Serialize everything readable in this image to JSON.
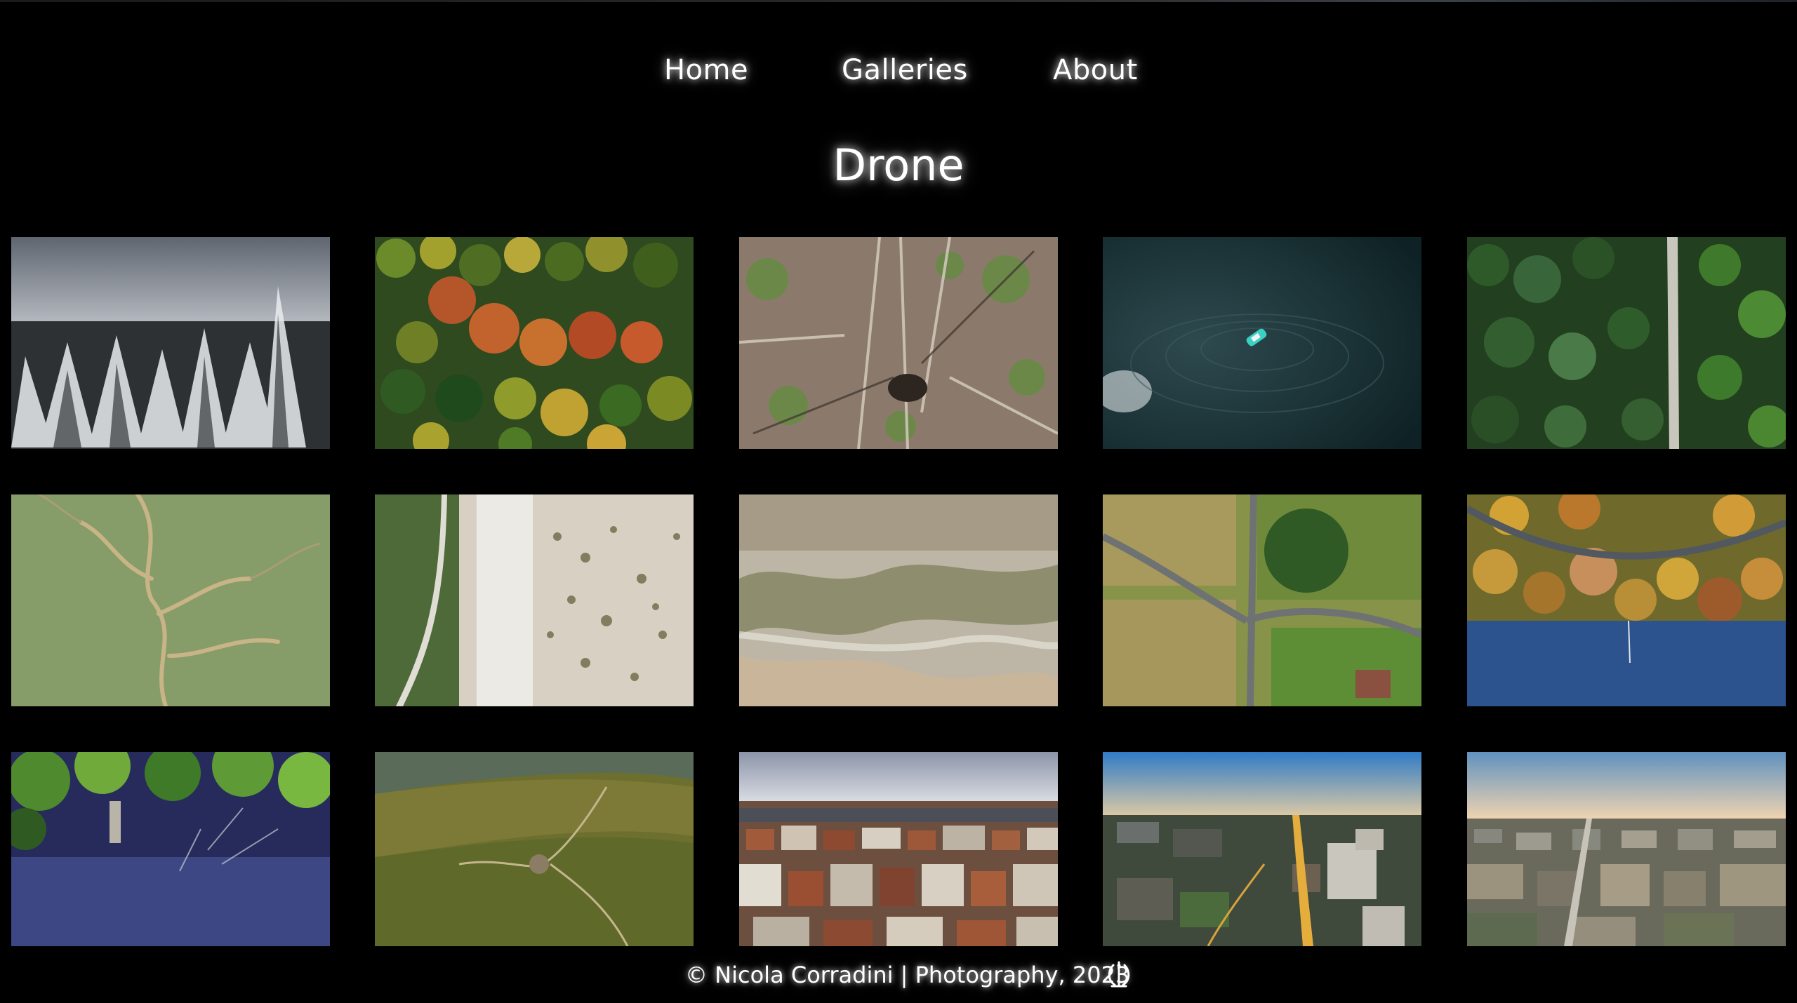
{
  "nav": {
    "items": [
      {
        "label": "Home"
      },
      {
        "label": "Galleries"
      },
      {
        "label": "About"
      }
    ]
  },
  "page_title": "Drone",
  "gallery": {
    "photos": [
      {
        "subject": "snow-covered forest"
      },
      {
        "subject": "autumn forest canopy"
      },
      {
        "subject": "fallen trees forest floor"
      },
      {
        "subject": "boat on dark lake"
      },
      {
        "subject": "pine forest with road"
      },
      {
        "subject": "tidal marsh channels"
      },
      {
        "subject": "dune path and beach"
      },
      {
        "subject": "tidal sand flats"
      },
      {
        "subject": "fields and road junction"
      },
      {
        "subject": "autumn trees by lake and road"
      },
      {
        "subject": "reflection of trees in pond"
      },
      {
        "subject": "green hills with stone hut"
      },
      {
        "subject": "city rooftops under clouds"
      },
      {
        "subject": "city avenue at dusk"
      },
      {
        "subject": "city skyline at sunset"
      }
    ]
  },
  "footer": {
    "text": "© Nicola Corradini | Photography, 2023",
    "logo_icon": "emblem-icon"
  },
  "colors": {
    "background": "#000000",
    "text": "#ffffff"
  }
}
